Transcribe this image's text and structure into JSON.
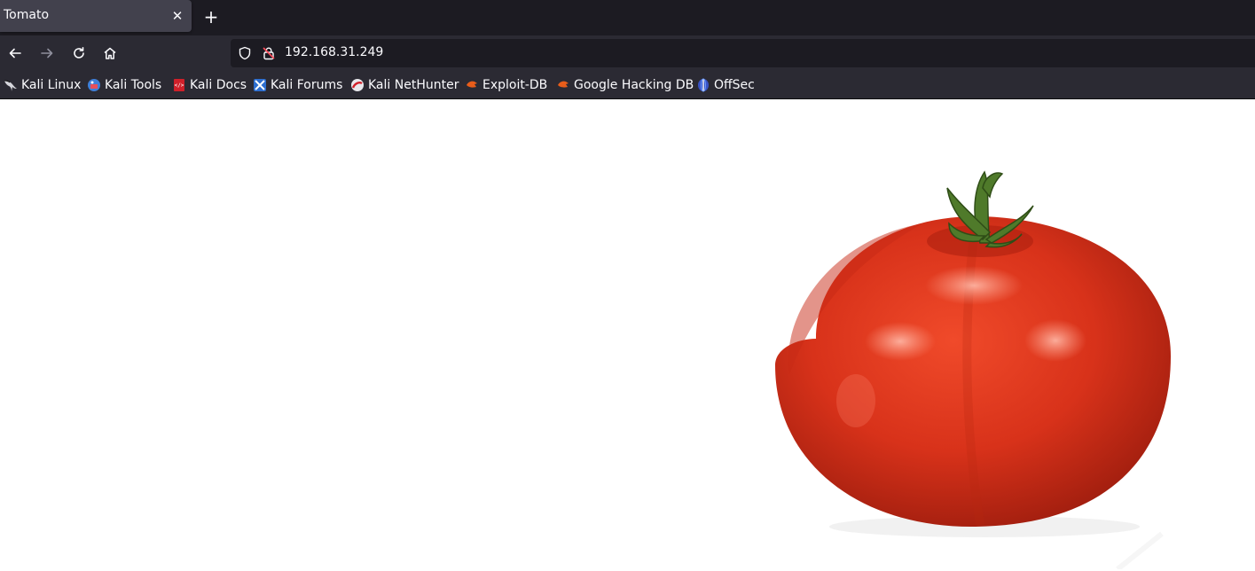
{
  "tab": {
    "title": "Tomato",
    "close_glyph": "✕"
  },
  "new_tab_glyph": "+",
  "nav": {
    "back_icon": "arrow-left-icon",
    "forward_icon": "arrow-right-icon",
    "reload_icon": "reload-icon",
    "home_icon": "home-icon"
  },
  "urlbar": {
    "url": "192.168.31.249"
  },
  "bookmarks": [
    {
      "label": "Kali Linux",
      "icon": "kali-dragon-icon"
    },
    {
      "label": "Kali Tools",
      "icon": "kali-tools-icon"
    },
    {
      "label": "Kali Docs",
      "icon": "kali-docs-icon"
    },
    {
      "label": "Kali Forums",
      "icon": "kali-forums-icon"
    },
    {
      "label": "Kali NetHunter",
      "icon": "kali-nethunter-icon"
    },
    {
      "label": "Exploit-DB",
      "icon": "exploit-db-icon"
    },
    {
      "label": "Google Hacking DB",
      "icon": "ghdb-icon"
    },
    {
      "label": "OffSec",
      "icon": "offsec-icon"
    }
  ],
  "colors": {
    "tab_bar": "#1c1b22",
    "toolbar": "#2b2a33",
    "active_tab": "#42414d",
    "text": "#fbfbfe",
    "tomato_red": "#d8321a"
  }
}
